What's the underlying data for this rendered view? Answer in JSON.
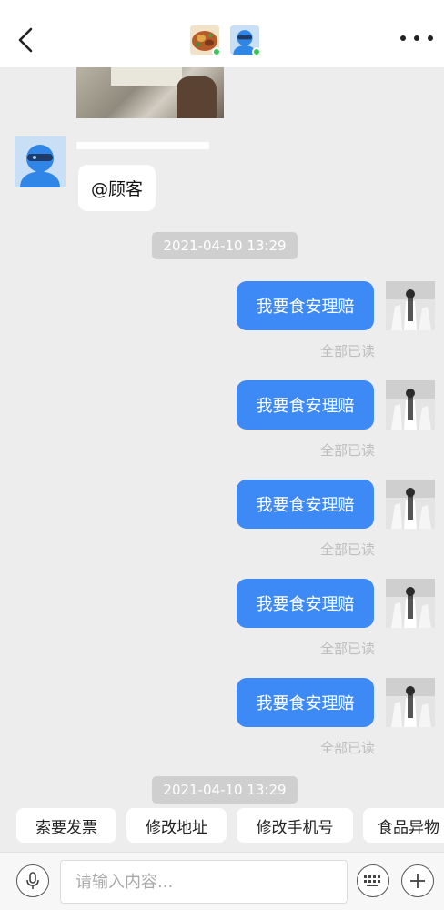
{
  "header": {
    "avatars": [
      {
        "icon": "food-dish-avatar-icon",
        "online": true
      },
      {
        "icon": "courier-helmet-avatar-icon",
        "online": true
      }
    ],
    "back_icon": "chevron-left-icon",
    "more_icon": "more-dots-icon",
    "online_color": "#34c759"
  },
  "conversation": {
    "incoming": {
      "text": "@顾客"
    },
    "timestamps": [
      "2021-04-10 13:29",
      "2021-04-10 13:29"
    ],
    "outgoing": [
      {
        "text": "我要食安理赔",
        "status": "全部已读"
      },
      {
        "text": "我要食安理赔",
        "status": "全部已读"
      },
      {
        "text": "我要食安理赔",
        "status": "全部已读"
      },
      {
        "text": "我要食安理赔",
        "status": "全部已读"
      },
      {
        "text": "我要食安理赔",
        "status": "全部已读"
      }
    ],
    "bubble_color": "#3d8af7"
  },
  "quick_replies": [
    "索要发票",
    "修改地址",
    "修改手机号",
    "食品异物"
  ],
  "input": {
    "placeholder": "请输入内容..."
  },
  "toolbar": {
    "voice_icon": "microphone-icon",
    "keyboard_icon": "keyboard-icon",
    "add_icon": "plus-icon"
  }
}
